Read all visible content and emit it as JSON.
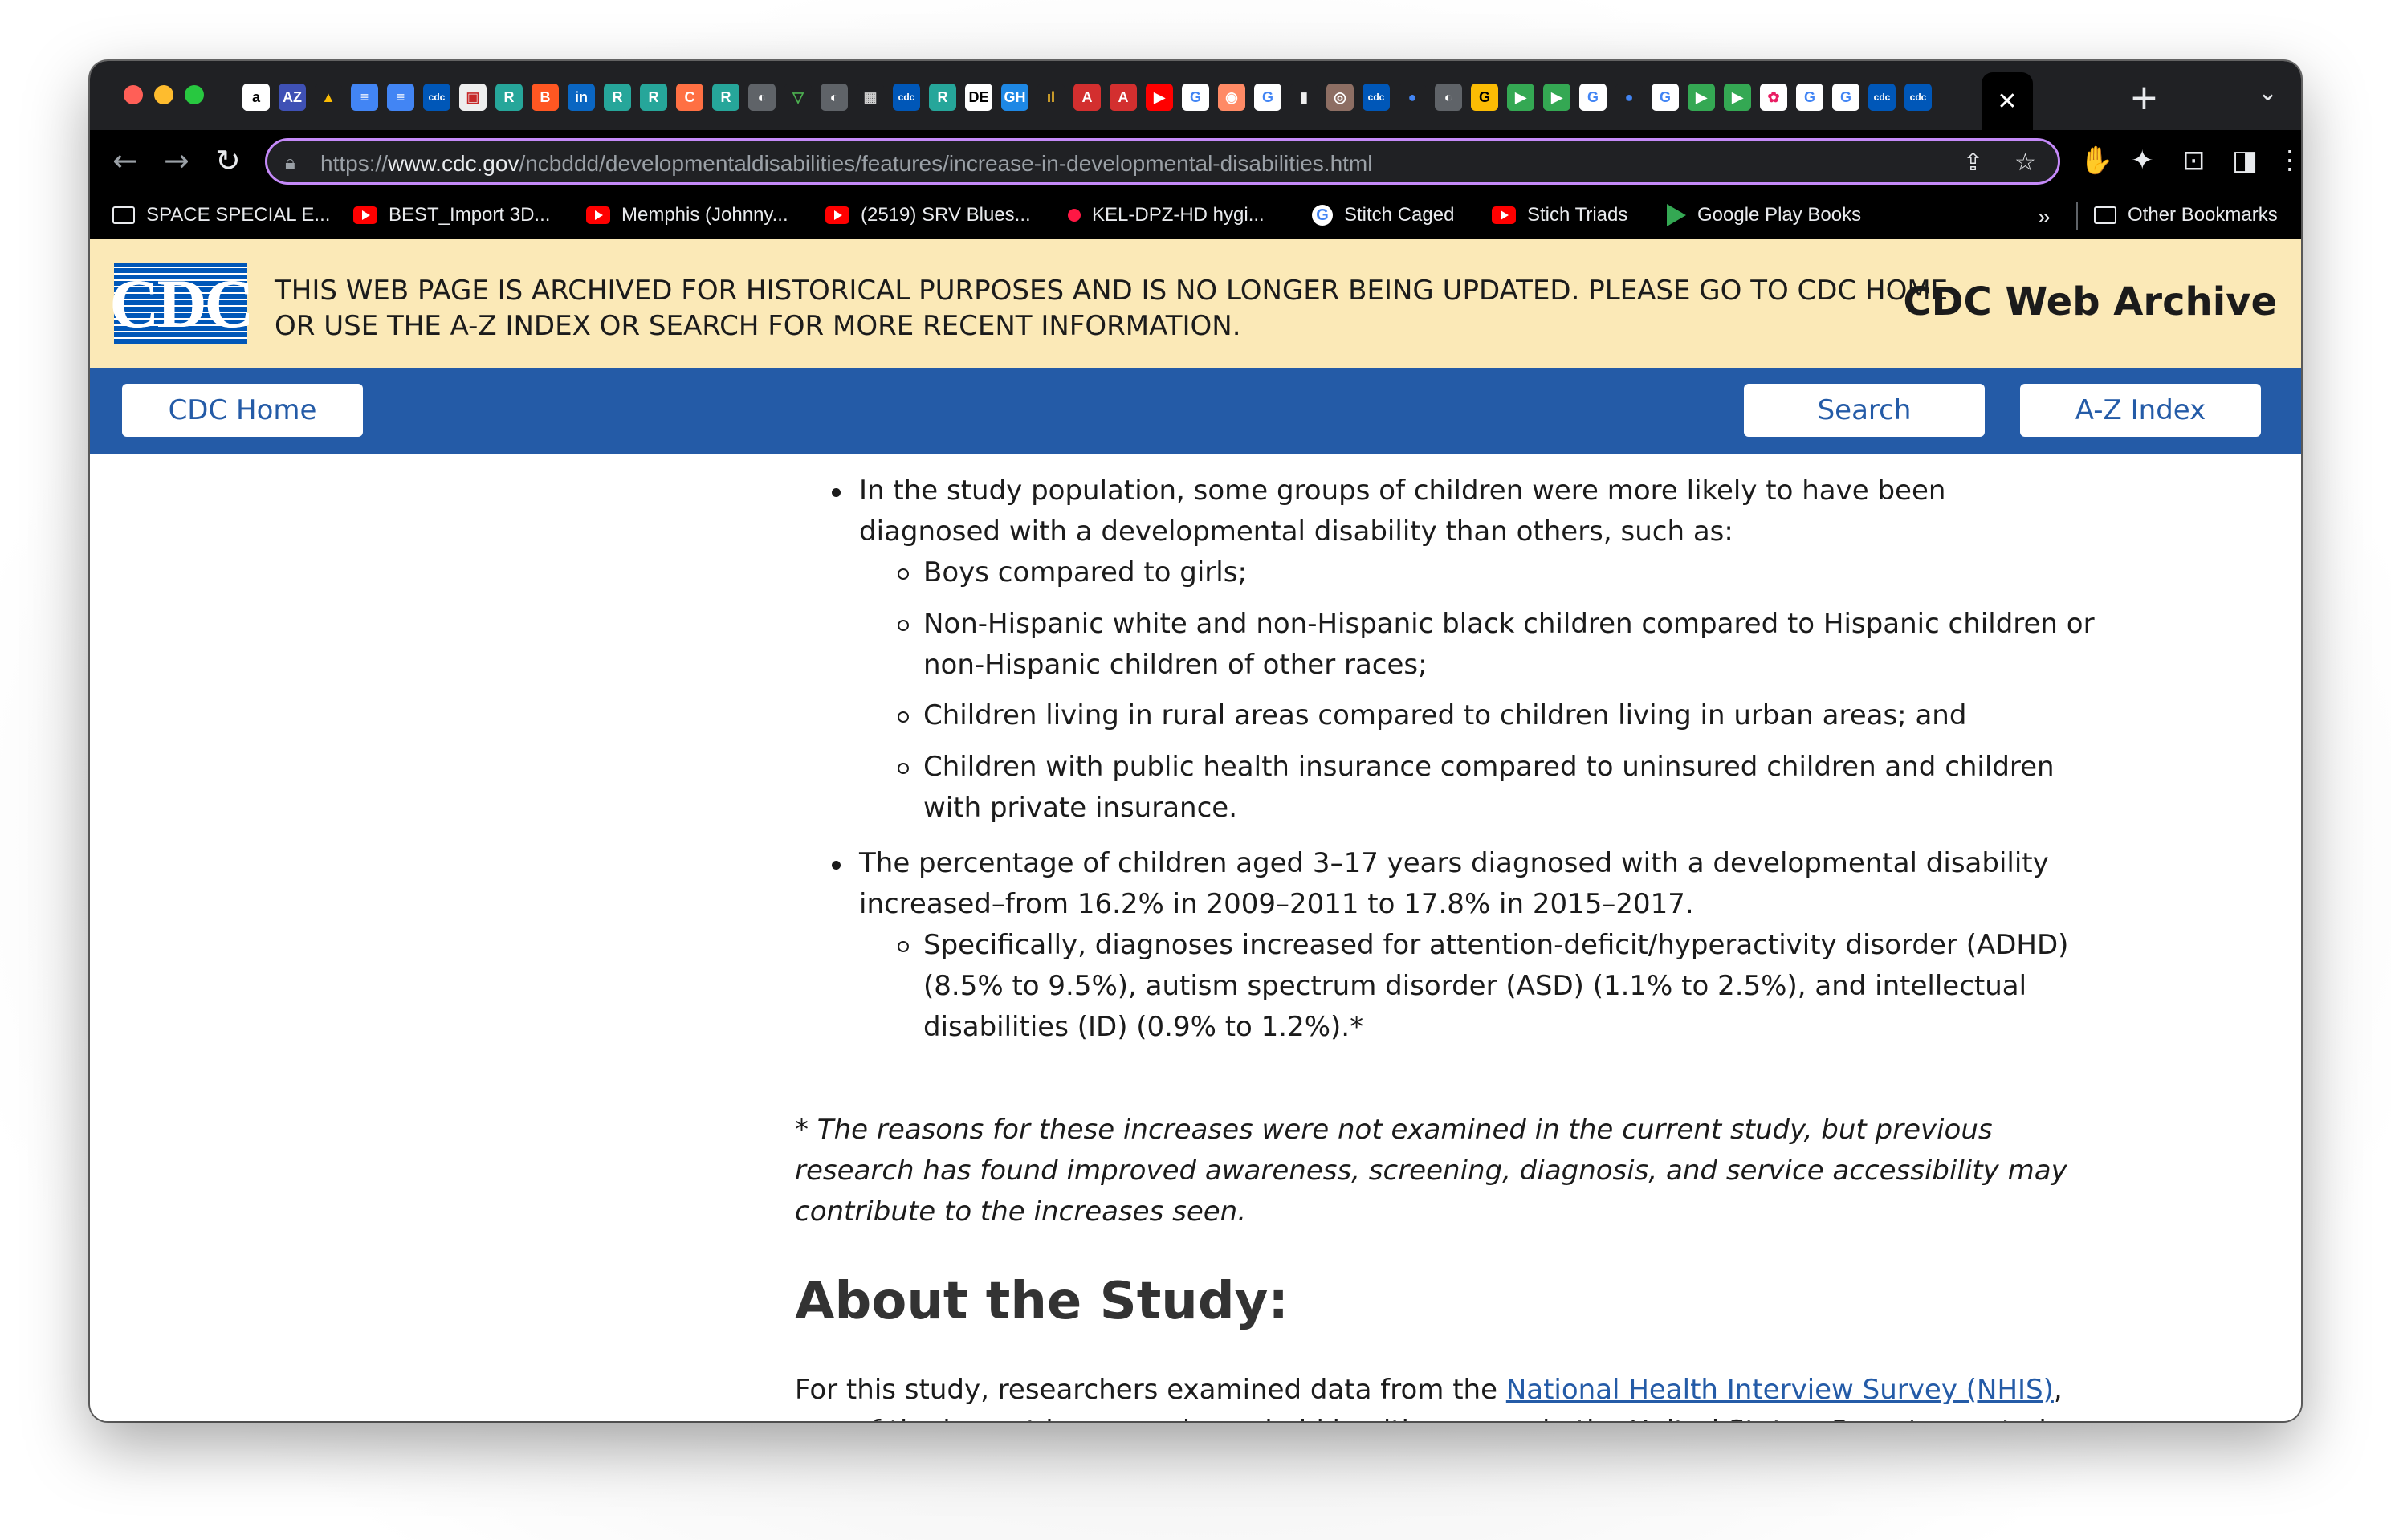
{
  "browser": {
    "url_scheme": "https://",
    "url_host": "www.cdc.gov",
    "url_path": "/ncbddd/developmentaldisabilities/features/increase-in-developmental-disabilities.html",
    "tab_close_glyph": "✕",
    "new_tab_glyph": "+",
    "tab_favicons": [
      {
        "label": "a",
        "color": "#ffffff",
        "text": "#000"
      },
      {
        "label": "AZ",
        "color": "#3f51b5",
        "text": "#fff"
      },
      {
        "label": "▲",
        "color": "#202124",
        "text": "#fbbc04"
      },
      {
        "label": "≡",
        "color": "#4285f4",
        "text": "#fff"
      },
      {
        "label": "≡",
        "color": "#4285f4",
        "text": "#fff"
      },
      {
        "label": "cdc",
        "color": "#0057b8",
        "text": "#fff"
      },
      {
        "label": "▣",
        "color": "#eeeeee",
        "text": "#c62828"
      },
      {
        "label": "R",
        "color": "#26a69a",
        "text": "#fff"
      },
      {
        "label": "B",
        "color": "#ff5722",
        "text": "#fff"
      },
      {
        "label": "in",
        "color": "#0a66c2",
        "text": "#fff"
      },
      {
        "label": "R",
        "color": "#26a69a",
        "text": "#fff"
      },
      {
        "label": "R",
        "color": "#26a69a",
        "text": "#fff"
      },
      {
        "label": "C",
        "color": "#ff7043",
        "text": "#fff"
      },
      {
        "label": "R",
        "color": "#26a69a",
        "text": "#fff"
      },
      {
        "label": "◐",
        "color": "#5f6368",
        "text": "#fff"
      },
      {
        "label": "▽",
        "color": "#202124",
        "text": "#4caf50"
      },
      {
        "label": "◐",
        "color": "#5f6368",
        "text": "#fff"
      },
      {
        "label": "▦",
        "color": "#202124",
        "text": "#ccc"
      },
      {
        "label": "cdc",
        "color": "#0057b8",
        "text": "#fff"
      },
      {
        "label": "R",
        "color": "#26a69a",
        "text": "#fff"
      },
      {
        "label": "DE",
        "color": "#ffffff",
        "text": "#000"
      },
      {
        "label": "GH",
        "color": "#1e88e5",
        "text": "#fff"
      },
      {
        "label": "ıl",
        "color": "#202124",
        "text": "#fbc02d"
      },
      {
        "label": "A",
        "color": "#d32f2f",
        "text": "#fff"
      },
      {
        "label": "A",
        "color": "#d32f2f",
        "text": "#fff"
      },
      {
        "label": "▶",
        "color": "#ff0000",
        "text": "#fff"
      },
      {
        "label": "G",
        "color": "#ffffff",
        "text": "#4285f4"
      },
      {
        "label": "◉",
        "color": "#ff8a65",
        "text": "#fff"
      },
      {
        "label": "G",
        "color": "#ffffff",
        "text": "#4285f4"
      },
      {
        "label": "▮",
        "color": "#202124",
        "text": "#eee"
      },
      {
        "label": "◎",
        "color": "#8d6e63",
        "text": "#fff"
      },
      {
        "label": "cdc",
        "color": "#0057b8",
        "text": "#fff"
      },
      {
        "label": "●",
        "color": "#202124",
        "text": "#4285f4"
      },
      {
        "label": "◐",
        "color": "#5f6368",
        "text": "#fff"
      },
      {
        "label": "G",
        "color": "#fbbc04",
        "text": "#000"
      },
      {
        "label": "▶",
        "color": "#34a853",
        "text": "#fff"
      },
      {
        "label": "▶",
        "color": "#34a853",
        "text": "#fff"
      },
      {
        "label": "G",
        "color": "#ffffff",
        "text": "#4285f4"
      },
      {
        "label": "●",
        "color": "#202124",
        "text": "#4285f4"
      },
      {
        "label": "G",
        "color": "#ffffff",
        "text": "#4285f4"
      },
      {
        "label": "▶",
        "color": "#34a853",
        "text": "#fff"
      },
      {
        "label": "▶",
        "color": "#34a853",
        "text": "#fff"
      },
      {
        "label": "✿",
        "color": "#ffffff",
        "text": "#e91e63"
      },
      {
        "label": "G",
        "color": "#ffffff",
        "text": "#4285f4"
      },
      {
        "label": "G",
        "color": "#ffffff",
        "text": "#4285f4"
      },
      {
        "label": "cdc",
        "color": "#0057b8",
        "text": "#fff"
      },
      {
        "label": "cdc",
        "color": "#0057b8",
        "text": "#fff"
      }
    ],
    "bookmarks": [
      {
        "label": "SPACE SPECIAL E...",
        "icon": "folder"
      },
      {
        "label": "BEST_Import 3D...",
        "icon": "youtube"
      },
      {
        "label": "Memphis (Johnny...",
        "icon": "youtube"
      },
      {
        "label": "(2519) SRV Blues...",
        "icon": "youtube"
      },
      {
        "label": "KEL-DPZ-HD hygi...",
        "icon": "dot"
      },
      {
        "label": "Stitch Caged",
        "icon": "google"
      },
      {
        "label": "Stich Triads",
        "icon": "youtube"
      },
      {
        "label": "Google Play Books",
        "icon": "play"
      }
    ],
    "bookmarks_more": "»",
    "other_bookmarks": "Other Bookmarks"
  },
  "archive_banner": {
    "logo": "CDC",
    "notice": "THIS WEB PAGE IS ARCHIVED FOR HISTORICAL PURPOSES AND IS NO LONGER BEING UPDATED. PLEASE GO TO CDC HOME OR USE THE A-Z INDEX OR SEARCH FOR MORE RECENT INFORMATION.",
    "title": "CDC Web Archive"
  },
  "nav": {
    "home": "CDC Home",
    "search": "Search",
    "az": "A-Z Index"
  },
  "content": {
    "bullet1": "In the study population, some groups of children were more likely to have been diagnosed with a developmental disability than others, such as:",
    "sub1": "Boys compared to girls;",
    "sub2": "Non-Hispanic white and non-Hispanic black children compared to Hispanic children or non-Hispanic children of other races;",
    "sub3": "Children living in rural areas compared to children living in urban areas; and",
    "sub4": "Children with public health insurance compared to uninsured children and children with private insurance.",
    "bullet2": "The percentage of children aged 3–17 years diagnosed with a developmental disability increased–from 16.2% in 2009–2011 to 17.8% in 2015–2017.",
    "sub5": "Specifically, diagnoses increased for attention-deficit/hyperactivity disorder (ADHD) (8.5% to 9.5%), autism spectrum disorder (ASD) (1.1% to 2.5%), and intellectual disabilities (ID) (0.9% to 1.2%).*",
    "footnote": "* The reasons for these increases were not examined in the current study, but previous research has found improved awareness, screening, diagnosis, and service accessibility may contribute to the increases seen.",
    "heading": "About the Study:",
    "para_before_link": "For this study, researchers examined data from the ",
    "link": "National Health Interview Survey (NHIS)",
    "para_after_link": ", one of the largest in-person household health surveys in the United States. Parent-reported data from"
  }
}
